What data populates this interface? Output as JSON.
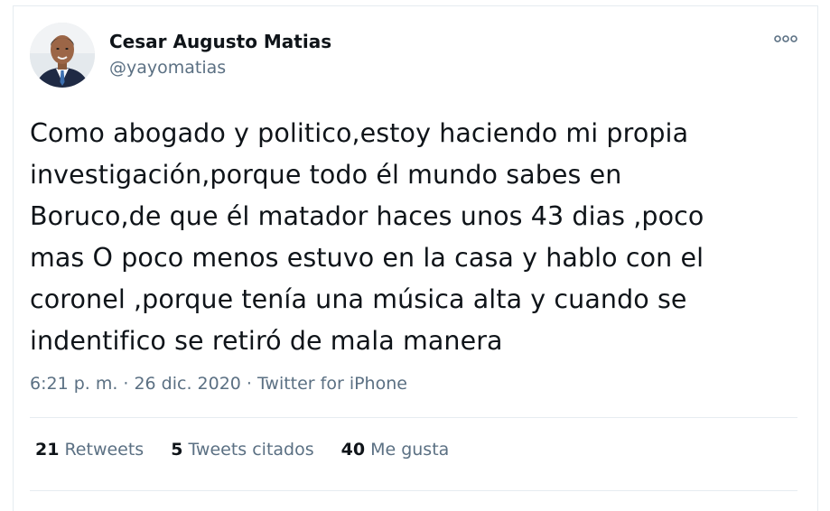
{
  "author": {
    "name": "Cesar Augusto Matias",
    "handle": "@yayomatias"
  },
  "tweet": {
    "text": "Como abogado y politico,estoy haciendo mi propia\ninvestigación,porque todo él mundo sabes en\nBoruco,de que él matador haces unos 43 dias ,poco\nmas O poco menos estuvo en la casa y hablo con el\ncoronel ,porque tenía una música alta y cuando se\nindentifico se retiró de mala manera",
    "time": "6:21 p. m.",
    "date": "26 dic. 2020",
    "separator": "·",
    "source": "Twitter for iPhone"
  },
  "stats": {
    "retweets_count": "21",
    "retweets_label": "Retweets",
    "quotes_count": "5",
    "quotes_label": "Tweets citados",
    "likes_count": "40",
    "likes_label": "Me gusta"
  },
  "icons": {
    "more": "more-options-icon",
    "avatar": "profile-photo"
  },
  "colors": {
    "text_primary": "#0f1419",
    "text_secondary": "#5b7083",
    "border": "#e6ecf0"
  }
}
